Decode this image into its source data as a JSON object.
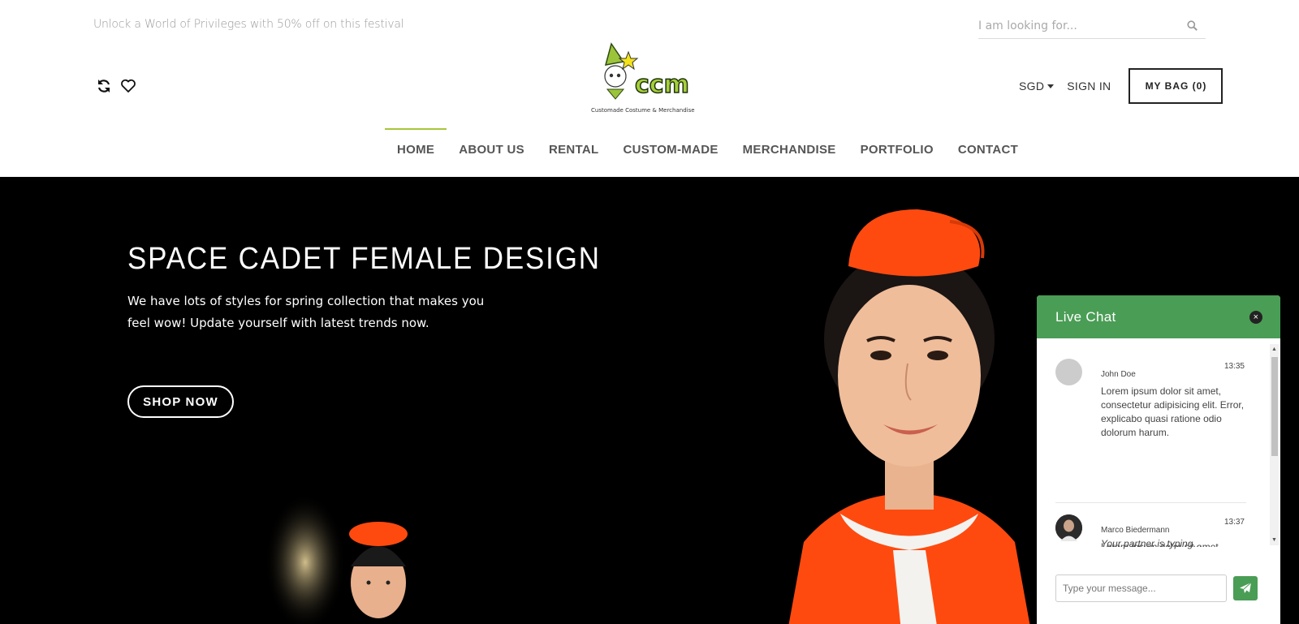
{
  "header": {
    "promo_text": "Unlock a World of Privileges with 50% off on this festival",
    "search_placeholder": "I am looking for...",
    "currency": "SGD",
    "sign_in": "SIGN IN",
    "bag_label": "MY BAG (0)",
    "logo_text": "CCM",
    "logo_tagline": "Customade Costume & Merchandise"
  },
  "nav": {
    "items": [
      {
        "label": "HOME"
      },
      {
        "label": "ABOUT US"
      },
      {
        "label": "RENTAL"
      },
      {
        "label": "CUSTOM-MADE"
      },
      {
        "label": "MERCHANDISE"
      },
      {
        "label": "PORTFOLIO"
      },
      {
        "label": "CONTACT"
      }
    ],
    "active_index": 0
  },
  "hero": {
    "title": "SPACE CADET FEMALE DESIGN",
    "subtitle": "We have lots of styles for spring collection that makes you feel wow! Update yourself with latest trends now.",
    "cta": "SHOP NOW"
  },
  "chat": {
    "title": "Live Chat",
    "close": "×",
    "messages": [
      {
        "name": "John Doe",
        "time": "13:35",
        "text": "Lorem ipsum dolor sit amet, consectetur adipisicing elit. Error, explicabo quasi ratione odio dolorum harum."
      },
      {
        "name": "Marco Biedermann",
        "time": "13:37",
        "text": "Lorem ipsum dolor sit amet, consectetur adipisicing elit. Blanditiis, nulla accusamus magni vel debitis numquam qui tempora rem voluptatem delectus!"
      }
    ],
    "typing": "Your partner is typing…",
    "input_placeholder": "Type your message..."
  },
  "colors": {
    "accent_green": "#4a9d55",
    "nav_active": "#a6c63a",
    "hero_bg": "#000000",
    "costume_orange": "#ff4a0f"
  }
}
